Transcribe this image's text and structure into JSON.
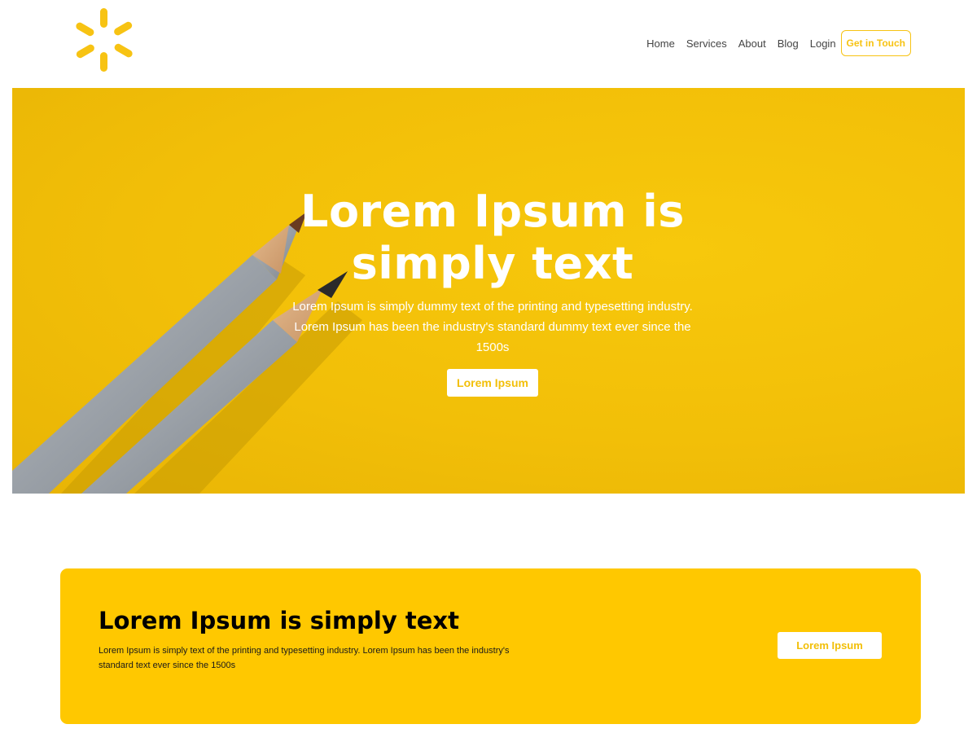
{
  "header": {
    "logo_icon": "spark-logo-icon",
    "nav": [
      {
        "label": "Home"
      },
      {
        "label": "Services"
      },
      {
        "label": "About"
      },
      {
        "label": "Blog"
      },
      {
        "label": "Login"
      }
    ],
    "cta_label": "Get in Touch"
  },
  "hero": {
    "title": "Lorem Ipsum is simply text",
    "text": "Lorem Ipsum is simply dummy text of the printing and typesetting industry. Lorem Ipsum has been the industry's standard dummy text ever since the 1500s",
    "button_label": "Lorem Ipsum",
    "background_color": "#f2bf08",
    "art_icon": "pencils-photo"
  },
  "banner": {
    "title": "Lorem Ipsum is simply text",
    "text": "Lorem Ipsum is simply text of the printing and typesetting industry. Lorem Ipsum has been the industry's standard text ever since the 1500s",
    "button_label": "Lorem Ipsum",
    "background_color": "#ffc800"
  },
  "colors": {
    "accent": "#f7c313",
    "white": "#ffffff",
    "text_dark": "#444444"
  }
}
